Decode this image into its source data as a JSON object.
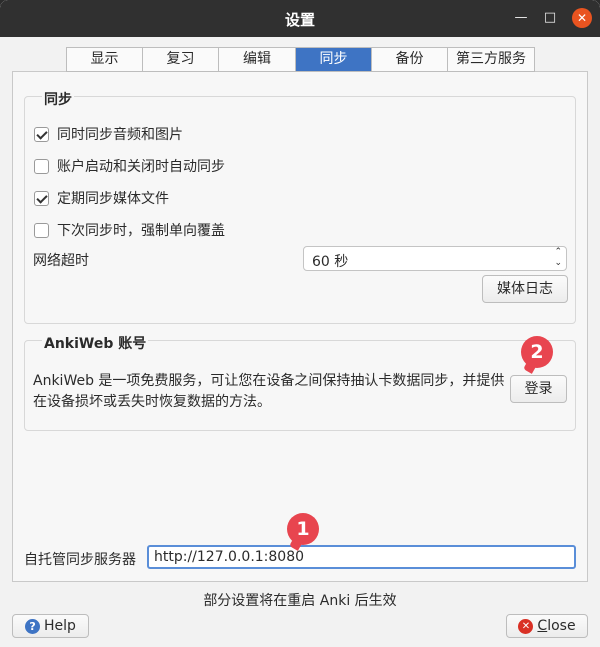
{
  "window": {
    "title": "设置",
    "min_glyph": "—",
    "max_glyph": "□",
    "close_glyph": "✕"
  },
  "tabs": [
    {
      "label": "显示",
      "active": false
    },
    {
      "label": "复习",
      "active": false
    },
    {
      "label": "编辑",
      "active": false
    },
    {
      "label": "同步",
      "active": true
    },
    {
      "label": "备份",
      "active": false
    },
    {
      "label": "第三方服务",
      "active": false
    }
  ],
  "sync_group": {
    "title": "同步",
    "options": [
      {
        "label": "同时同步音频和图片",
        "checked": true
      },
      {
        "label": "账户启动和关闭时自动同步",
        "checked": false
      },
      {
        "label": "定期同步媒体文件",
        "checked": true
      },
      {
        "label": "下次同步时，强制单向覆盖",
        "checked": false
      }
    ],
    "timeout_label": "网络超时",
    "timeout_value": "60 秒",
    "media_log_button": "媒体日志"
  },
  "ankiweb_group": {
    "title": "AnkiWeb 账号",
    "description_line1": "AnkiWeb 是一项免费服务，可让您在设备之间保持抽认卡数据同步，并提供",
    "description_line2": "在设备损坏或丢失时恢复数据的方法。",
    "login_button": "登录"
  },
  "annotations": {
    "badge1": "1",
    "badge2": "2",
    "badge_color": "#e8454f"
  },
  "self_hosted": {
    "label": "自托管同步服务器",
    "value": "http://127.0.0.1:8080"
  },
  "notice": "部分设置将在重启 Anki 后生效",
  "bottom": {
    "help_label": "Help",
    "close_label_prefix": "C",
    "close_label_rest": "lose",
    "help_icon": "?",
    "close_icon": "✕"
  },
  "colors": {
    "accent": "#3e74c4",
    "titlebar": "#303030",
    "close_button": "#e95420"
  }
}
